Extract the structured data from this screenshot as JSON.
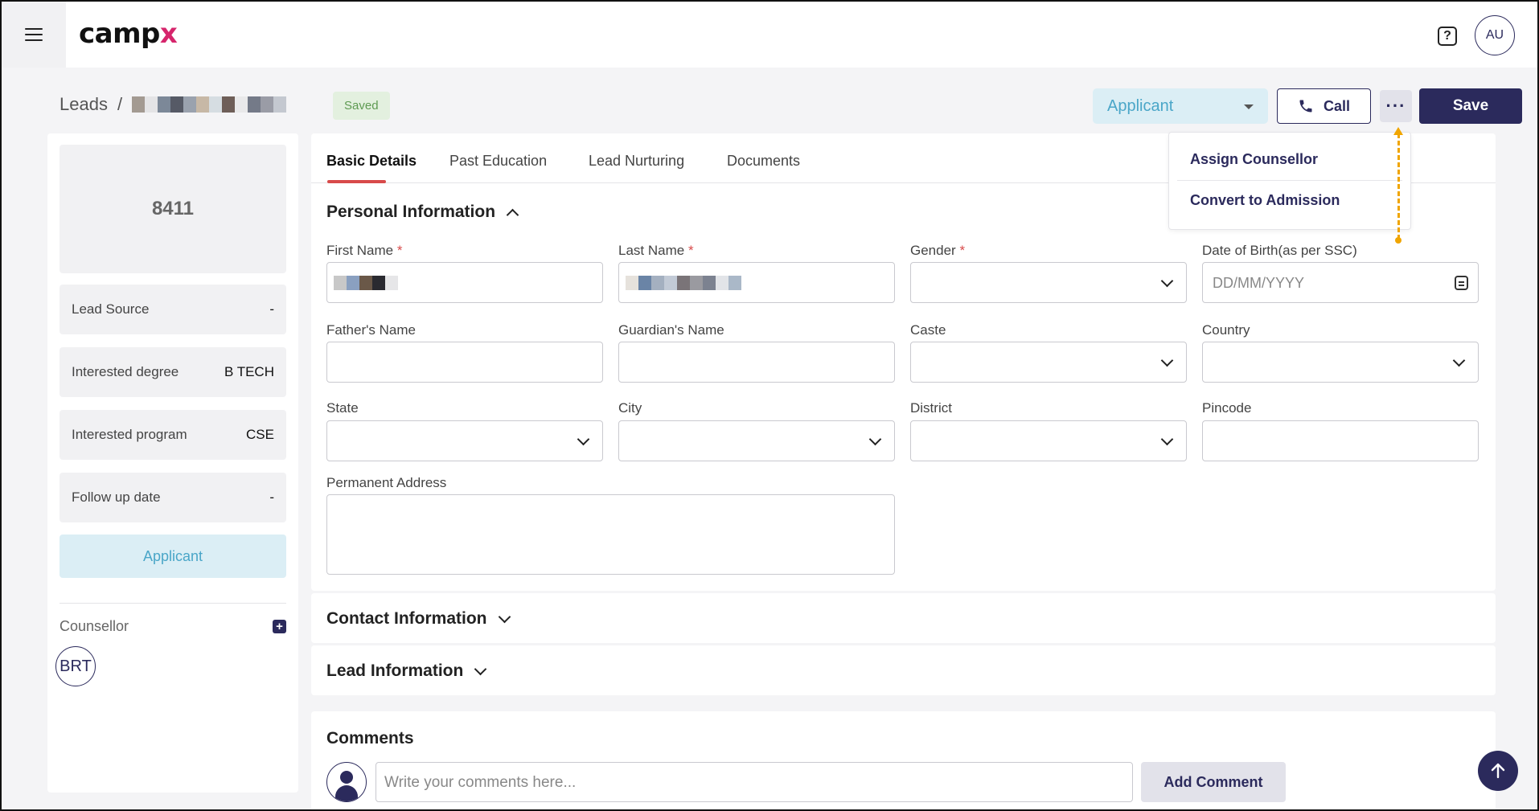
{
  "header": {
    "logo_text": "camp",
    "logo_x": "x",
    "help_label": "?",
    "user_initials": "AU"
  },
  "breadcrumb": {
    "root": "Leads",
    "separator": "/",
    "saved_badge": "Saved"
  },
  "actions": {
    "status_value": "Applicant",
    "call_label": "Call",
    "more_label": "···",
    "save_label": "Save"
  },
  "more_menu": {
    "items": [
      "Assign Counsellor",
      "Convert to Admission"
    ]
  },
  "sidebar": {
    "lead_id": "8411",
    "rows": [
      {
        "label": "Lead Source",
        "value": "-"
      },
      {
        "label": "Interested degree",
        "value": "B TECH"
      },
      {
        "label": "Interested program",
        "value": "CSE"
      },
      {
        "label": "Follow up date",
        "value": "-"
      }
    ],
    "status": "Applicant",
    "counsellor_label": "Counsellor",
    "counsellor_add": "+",
    "counsellor_initials": "BRT"
  },
  "tabs": [
    "Basic Details",
    "Past Education",
    "Lead Nurturing",
    "Documents"
  ],
  "personal": {
    "title": "Personal Information",
    "fields": {
      "first_name": "First Name",
      "last_name": "Last Name",
      "gender": "Gender",
      "dob": "Date of Birth(as per SSC)",
      "dob_placeholder": "DD/MM/YYYY",
      "father": "Father's Name",
      "guardian": "Guardian's Name",
      "caste": "Caste",
      "country": "Country",
      "state": "State",
      "city": "City",
      "district": "District",
      "pincode": "Pincode",
      "address": "Permanent Address"
    },
    "required_mark": "*"
  },
  "contact": {
    "title": "Contact Information"
  },
  "lead_info": {
    "title": "Lead Information"
  },
  "comments": {
    "title": "Comments",
    "placeholder": "Write your comments here...",
    "add_label": "Add Comment"
  },
  "colors": {
    "brand": "#2b2a5c",
    "accent": "#d6256c",
    "applicant_bg": "#dbeef5",
    "applicant_text": "#4aa6c8",
    "saved_bg": "#e3f0df",
    "saved_text": "#5e9a52",
    "active_tab": "#d84a4a",
    "annotation_arrow": "#f0a500"
  }
}
